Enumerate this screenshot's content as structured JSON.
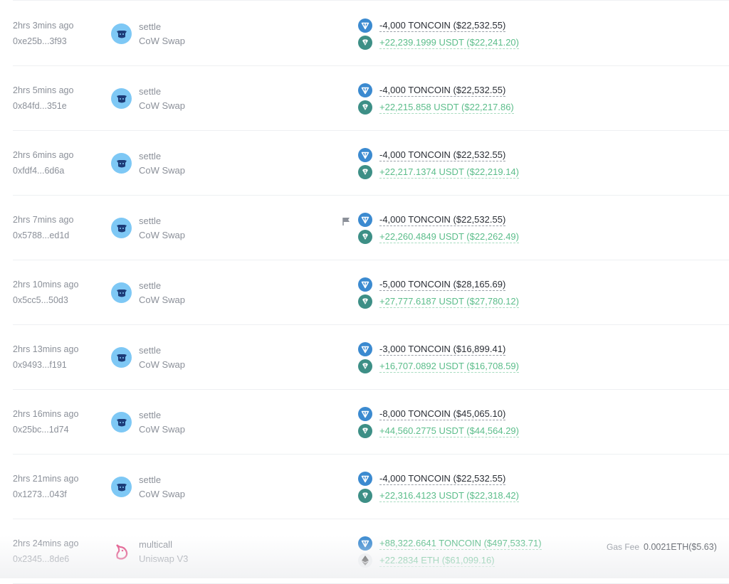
{
  "rows": [
    {
      "time": "2hrs 3mins ago",
      "hash": "0xe25b...3f93",
      "method": "settle",
      "protocol": "CoW Swap",
      "flag": false,
      "out": {
        "text": "-4,000 TONCOIN ($22,532.55)",
        "token": "TONCOIN"
      },
      "in": {
        "text": "+22,239.1999 USDT ($22,241.20)",
        "token": "USDT"
      }
    },
    {
      "time": "2hrs 5mins ago",
      "hash": "0x84fd...351e",
      "method": "settle",
      "protocol": "CoW Swap",
      "flag": false,
      "out": {
        "text": "-4,000 TONCOIN ($22,532.55)",
        "token": "TONCOIN"
      },
      "in": {
        "text": "+22,215.858 USDT ($22,217.86)",
        "token": "USDT"
      }
    },
    {
      "time": "2hrs 6mins ago",
      "hash": "0xfdf4...6d6a",
      "method": "settle",
      "protocol": "CoW Swap",
      "flag": false,
      "out": {
        "text": "-4,000 TONCOIN ($22,532.55)",
        "token": "TONCOIN"
      },
      "in": {
        "text": "+22,217.1374 USDT ($22,219.14)",
        "token": "USDT"
      }
    },
    {
      "time": "2hrs 7mins ago",
      "hash": "0x5788...ed1d",
      "method": "settle",
      "protocol": "CoW Swap",
      "flag": true,
      "out": {
        "text": "-4,000 TONCOIN ($22,532.55)",
        "token": "TONCOIN"
      },
      "in": {
        "text": "+22,260.4849 USDT ($22,262.49)",
        "token": "USDT"
      }
    },
    {
      "time": "2hrs 10mins ago",
      "hash": "0x5cc5...50d3",
      "method": "settle",
      "protocol": "CoW Swap",
      "flag": false,
      "out": {
        "text": "-5,000 TONCOIN ($28,165.69)",
        "token": "TONCOIN"
      },
      "in": {
        "text": "+27,777.6187 USDT ($27,780.12)",
        "token": "USDT"
      }
    },
    {
      "time": "2hrs 13mins ago",
      "hash": "0x9493...f191",
      "method": "settle",
      "protocol": "CoW Swap",
      "flag": false,
      "out": {
        "text": "-3,000 TONCOIN ($16,899.41)",
        "token": "TONCOIN"
      },
      "in": {
        "text": "+16,707.0892 USDT ($16,708.59)",
        "token": "USDT"
      }
    },
    {
      "time": "2hrs 16mins ago",
      "hash": "0x25bc...1d74",
      "method": "settle",
      "protocol": "CoW Swap",
      "flag": false,
      "out": {
        "text": "-8,000 TONCOIN ($45,065.10)",
        "token": "TONCOIN"
      },
      "in": {
        "text": "+44,560.2775 USDT ($44,564.29)",
        "token": "USDT"
      }
    },
    {
      "time": "2hrs 21mins ago",
      "hash": "0x1273...043f",
      "method": "settle",
      "protocol": "CoW Swap",
      "flag": false,
      "out": {
        "text": "-4,000 TONCOIN ($22,532.55)",
        "token": "TONCOIN"
      },
      "in": {
        "text": "+22,316.4123 USDT ($22,318.42)",
        "token": "USDT"
      }
    },
    {
      "time": "2hrs 24mins ago",
      "hash": "0x2345...8de6",
      "method": "multicall",
      "protocol": "Uniswap V3",
      "flag": false,
      "out": {
        "text": "+88,322.6641 TONCOIN ($497,533.71)",
        "token": "TONCOIN",
        "positive": true
      },
      "in": {
        "text": "+22.2834 ETH ($61,099.16)",
        "token": "ETH"
      },
      "gas_label": "Gas Fee",
      "gas_value": "0.0021ETH($5.63)"
    }
  ],
  "colors": {
    "ton": "#3b8ad0",
    "usdt": "#3d8f86",
    "positive": "#5bbd8a",
    "cow": "#7ec8f5",
    "uniswap": "#e0407b"
  }
}
